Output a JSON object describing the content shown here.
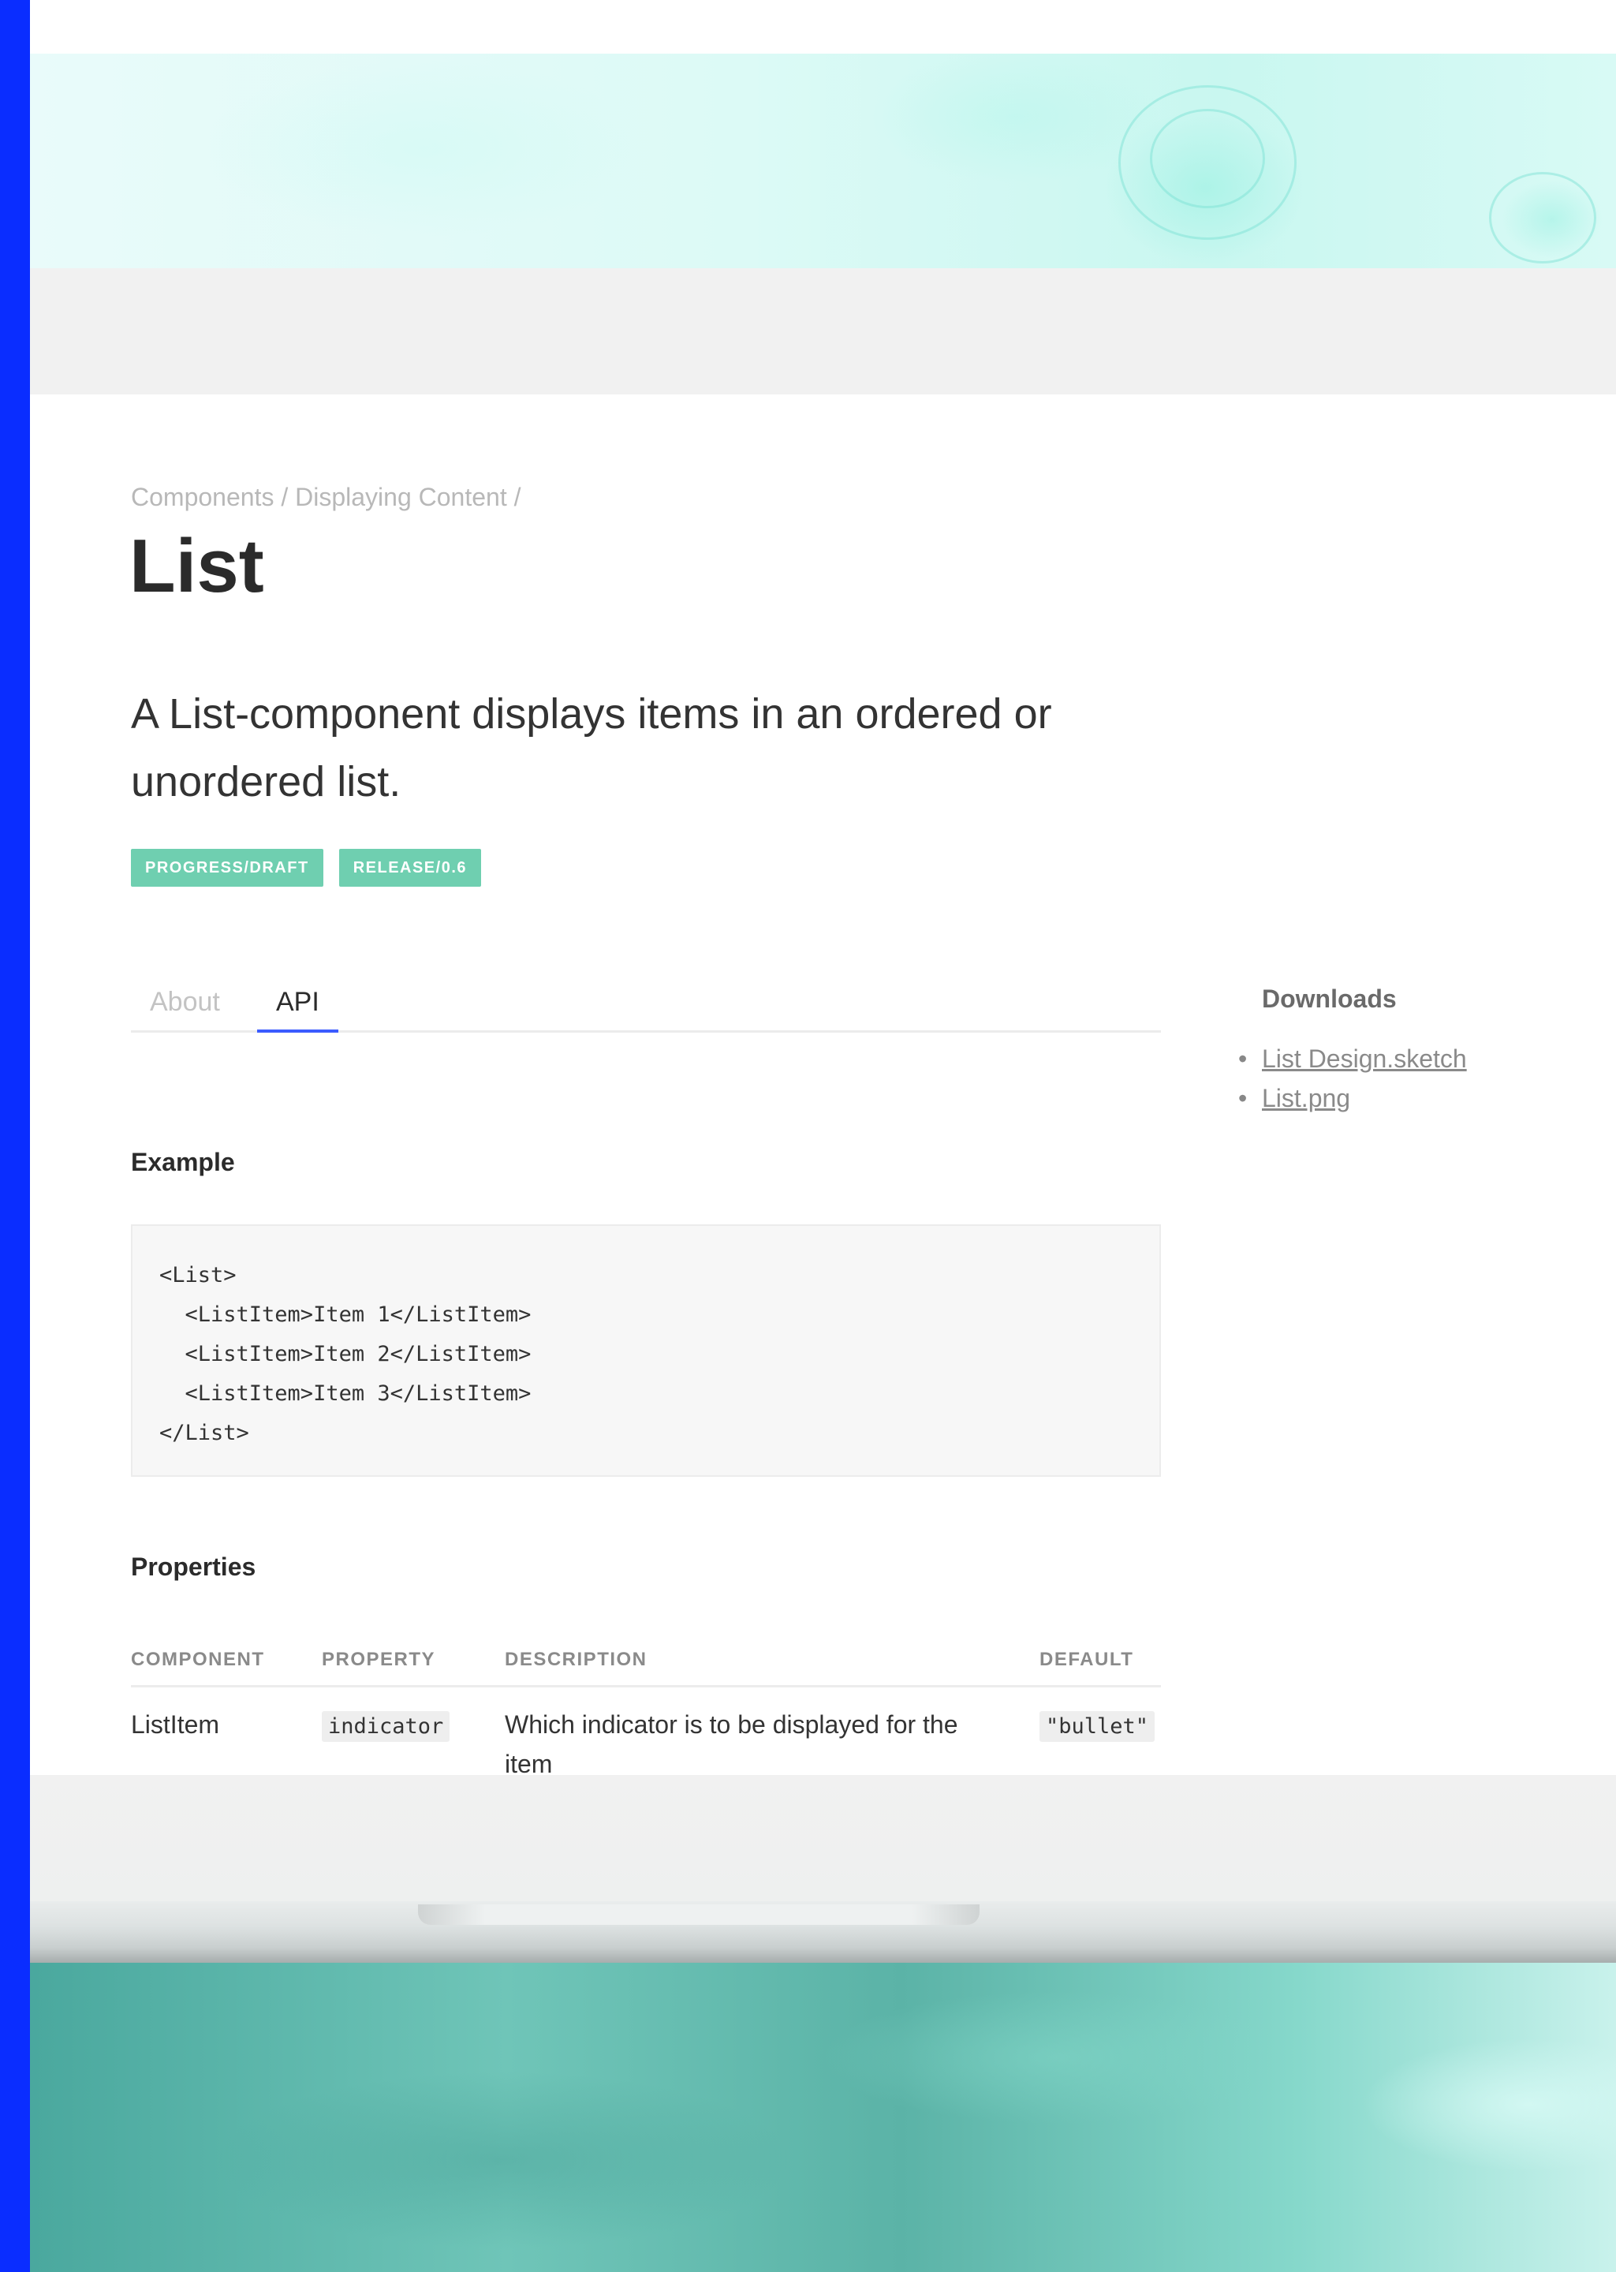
{
  "breadcrumb": "Components / Displaying Content /",
  "page": {
    "title": "List",
    "lead": "A List-component displays items in an ordered or unordered list."
  },
  "badges": [
    "PROGRESS/DRAFT",
    "RELEASE/0.6"
  ],
  "tabs": {
    "about": "About",
    "api": "API",
    "active": "API"
  },
  "example": {
    "heading": "Example",
    "code": [
      "<List>",
      "  <ListItem>Item 1</ListItem>",
      "  <ListItem>Item 2</ListItem>",
      "  <ListItem>Item 3</ListItem>",
      "</List>"
    ]
  },
  "properties": {
    "heading": "Properties",
    "columns": [
      "COMPONENT",
      "PROPERTY",
      "DESCRIPTION",
      "DEFAULT"
    ],
    "rows": [
      {
        "component": "ListItem",
        "property": "indicator",
        "description": "Which indicator is to be displayed for the item",
        "default": "\"bullet\""
      }
    ]
  },
  "sidebar": {
    "heading": "Downloads",
    "links": [
      "List Design.sketch",
      "List.png"
    ]
  },
  "colors": {
    "accent": "#3b5bff",
    "badge": "#6fcfb0",
    "frame": "#0a2dff"
  }
}
